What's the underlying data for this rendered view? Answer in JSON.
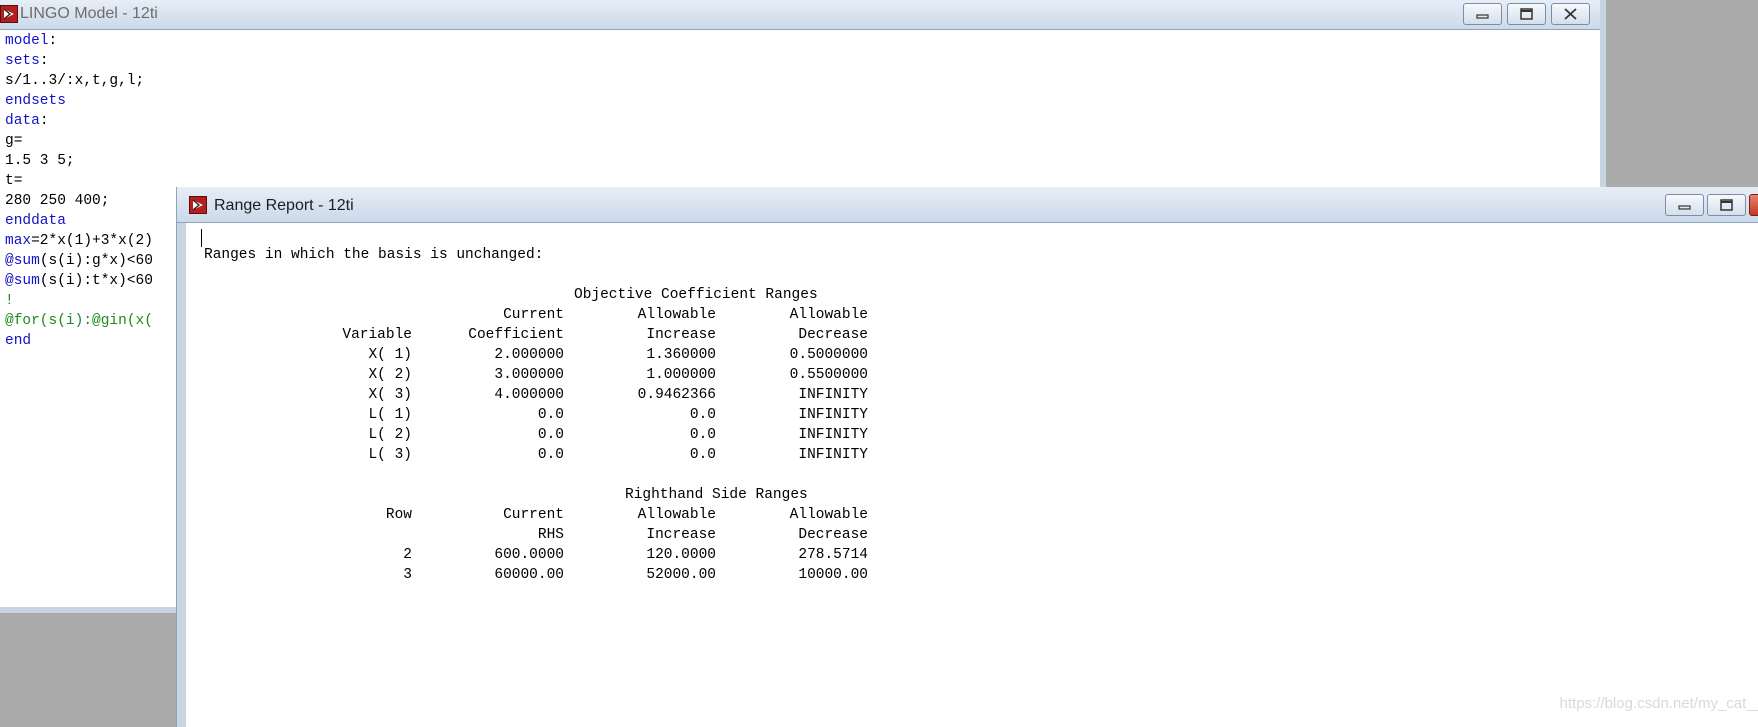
{
  "model_window": {
    "title": "LINGO Model - 12ti",
    "lines": [
      [
        {
          "t": "model",
          "c": "kw"
        },
        {
          "t": ":",
          "c": ""
        }
      ],
      [
        {
          "t": "sets",
          "c": "kw"
        },
        {
          "t": ":",
          "c": ""
        }
      ],
      [
        {
          "t": "s/1..3/:x,t,g,l;",
          "c": ""
        }
      ],
      [
        {
          "t": "endsets",
          "c": "kw"
        }
      ],
      [
        {
          "t": "data",
          "c": "kw"
        },
        {
          "t": ":",
          "c": ""
        }
      ],
      [
        {
          "t": "g=",
          "c": ""
        }
      ],
      [
        {
          "t": "1.5 3 5;",
          "c": ""
        }
      ],
      [
        {
          "t": "t=",
          "c": ""
        }
      ],
      [
        {
          "t": "280 250 400;",
          "c": ""
        }
      ],
      [
        {
          "t": "enddata",
          "c": "kw"
        }
      ],
      [
        {
          "t": "max",
          "c": "kw"
        },
        {
          "t": "=2*x(1)+3*x(2)",
          "c": ""
        }
      ],
      [
        {
          "t": "@sum",
          "c": "kw"
        },
        {
          "t": "(s(i):g*x)<60",
          "c": ""
        }
      ],
      [
        {
          "t": "@sum",
          "c": "kw"
        },
        {
          "t": "(s(i):t*x)<60",
          "c": ""
        }
      ],
      [
        {
          "t": "!",
          "c": "fn"
        }
      ],
      [
        {
          "t": "@for(s(i):@gin(x(",
          "c": "fn"
        }
      ],
      [
        {
          "t": "end",
          "c": "kw"
        }
      ]
    ]
  },
  "report_window": {
    "title": "Range Report - 12ti",
    "intro": "Ranges in which the basis is unchanged:",
    "objective": {
      "heading": "Objective Coefficient Ranges",
      "header1": [
        "",
        "Current",
        "Allowable",
        "Allowable"
      ],
      "header2": [
        "Variable",
        "Coefficient",
        "Increase",
        "Decrease"
      ],
      "rows": [
        [
          "X( 1)",
          "2.000000",
          "1.360000",
          "0.5000000"
        ],
        [
          "X( 2)",
          "3.000000",
          "1.000000",
          "0.5500000"
        ],
        [
          "X( 3)",
          "4.000000",
          "0.9462366",
          "INFINITY"
        ],
        [
          "L( 1)",
          "0.0",
          "0.0",
          "INFINITY"
        ],
        [
          "L( 2)",
          "0.0",
          "0.0",
          "INFINITY"
        ],
        [
          "L( 3)",
          "0.0",
          "0.0",
          "INFINITY"
        ]
      ]
    },
    "rhs": {
      "heading": "Righthand Side Ranges",
      "header1": [
        "Row",
        "Current",
        "Allowable",
        "Allowable"
      ],
      "header2": [
        "",
        "RHS",
        "Increase",
        "Decrease"
      ],
      "rows": [
        [
          "2",
          "600.0000",
          "120.0000",
          "278.5714"
        ],
        [
          "3",
          "60000.00",
          "52000.00",
          "10000.00"
        ]
      ]
    }
  },
  "watermark": "https://blog.csdn.net/my_cat__",
  "icons": {
    "app": "lingo-app-icon",
    "minimize": "minimize-icon",
    "maximize": "maximize-icon",
    "close": "close-icon"
  },
  "colors": {
    "keyword": "#1212c8",
    "function": "#1d8a1d",
    "background": "#ababab"
  }
}
